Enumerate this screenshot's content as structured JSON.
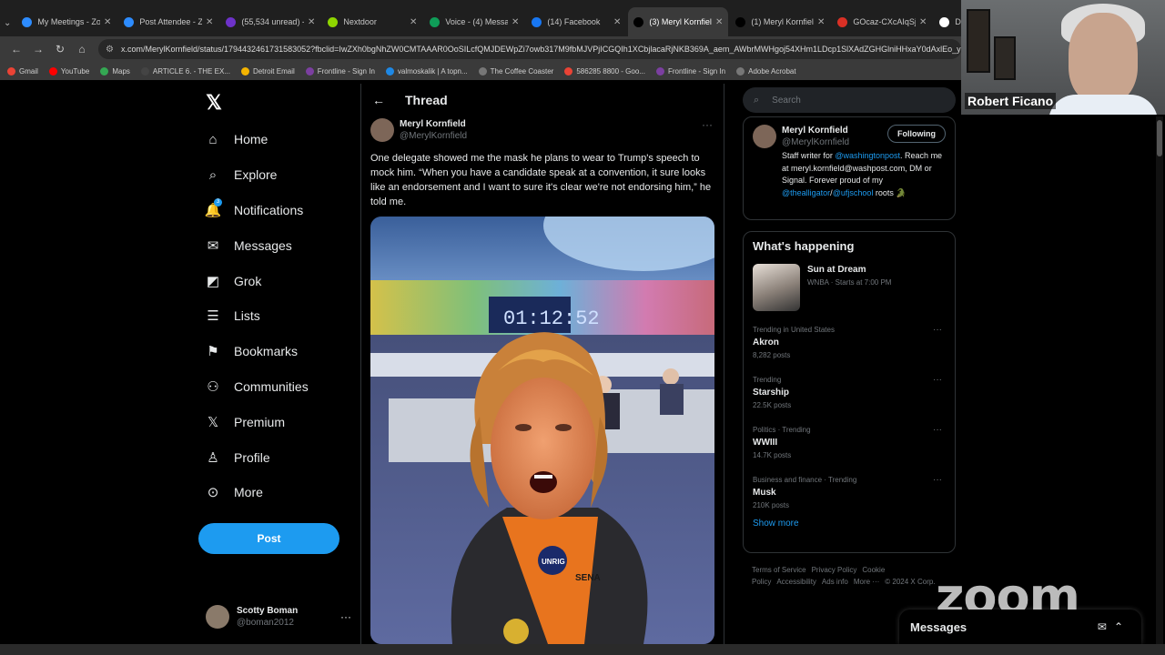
{
  "browser": {
    "tabs": [
      {
        "title": "My Meetings - Zo",
        "color": "#2d8cff",
        "icon": "zoom-icon"
      },
      {
        "title": "Post Attendee - Z",
        "color": "#2d8cff",
        "icon": "zoom-icon"
      },
      {
        "title": "(55,534 unread) -",
        "color": "#6d32c9",
        "icon": "mail-icon"
      },
      {
        "title": "Nextdoor",
        "color": "#8ed500",
        "icon": "nextdoor-icon"
      },
      {
        "title": "Voice - (4) Messag",
        "color": "#0f9d58",
        "icon": "phone-icon"
      },
      {
        "title": "(14) Facebook",
        "color": "#1877f2",
        "icon": "facebook-icon"
      },
      {
        "title": "(3) Meryl Kornfiel",
        "color": "#000000",
        "icon": "x-icon",
        "active": true
      },
      {
        "title": "(1) Meryl Kornfiel",
        "color": "#000000",
        "icon": "x-icon"
      },
      {
        "title": "GOcaz-CXcAIqSji",
        "color": "#d93025",
        "icon": "image-icon"
      },
      {
        "title": "Do",
        "color": "#ffffff",
        "icon": "doc-icon"
      }
    ],
    "url": "x.com/MerylKornfield/status/1794432461731583052?fbclid=IwZXh0bgNhZW0CMTAAAR0OoSILcfQMJDEWpZi7owb317M9fbMJVPjICGQIh1XCbjlacaRjNKB369A_aem_AWbrMWHgoj54XHm1LDcp1SlXAdZGHGlniHHxaY0dAxlEo_y",
    "bookmarks": [
      {
        "label": "Gmail",
        "color": "#ea4335"
      },
      {
        "label": "YouTube",
        "color": "#ff0000"
      },
      {
        "label": "Maps",
        "color": "#34a853"
      },
      {
        "label": "ARTICLE 6. - THE EX...",
        "color": "#444444"
      },
      {
        "label": "Detroit Email",
        "color": "#f4b400"
      },
      {
        "label": "Frontline - Sign In",
        "color": "#7b3fa0"
      },
      {
        "label": "valmoskalik | A topn...",
        "color": "#1e88e5"
      },
      {
        "label": "The Coffee Coaster",
        "color": "#777777"
      },
      {
        "label": "586285 8800 - Goo...",
        "color": "#ea4335"
      },
      {
        "label": "Frontline - Sign In",
        "color": "#7b3fa0"
      },
      {
        "label": "Adobe Acrobat",
        "color": "#777777"
      }
    ]
  },
  "video": {
    "participant_name": "Robert Ficano"
  },
  "nav": {
    "items": [
      {
        "label": "Home",
        "icon": "home-icon",
        "glyph": "⌂"
      },
      {
        "label": "Explore",
        "icon": "search-icon",
        "glyph": "⌕"
      },
      {
        "label": "Notifications",
        "icon": "bell-icon",
        "glyph": "🔔",
        "badge": "3"
      },
      {
        "label": "Messages",
        "icon": "mail-icon",
        "glyph": "✉"
      },
      {
        "label": "Grok",
        "icon": "grok-icon",
        "glyph": "◩"
      },
      {
        "label": "Lists",
        "icon": "list-icon",
        "glyph": "☰"
      },
      {
        "label": "Bookmarks",
        "icon": "bookmark-icon",
        "glyph": "⚑"
      },
      {
        "label": "Communities",
        "icon": "communities-icon",
        "glyph": "⚇"
      },
      {
        "label": "Premium",
        "icon": "x-premium-icon",
        "glyph": "𝕏"
      },
      {
        "label": "Profile",
        "icon": "profile-icon",
        "glyph": "♙"
      },
      {
        "label": "More",
        "icon": "more-circle-icon",
        "glyph": "⊙"
      }
    ],
    "post_label": "Post",
    "account": {
      "name": "Scotty Boman",
      "handle": "@boman2012"
    }
  },
  "thread": {
    "title": "Thread",
    "author_name": "Meryl Kornfield",
    "author_handle": "@MerylKornfield",
    "text": "One delegate showed me the mask he plans to wear to Trump's speech to mock  him. “When you have a candidate speak at a convention, it sure looks like an endorsement and I want to sure it's clear we're not endorsing him,” he told me.",
    "media_clock": "01:12:52",
    "media_button": "UNRIG",
    "media_shirt": "SENA"
  },
  "sidebar": {
    "search_placeholder": "Search",
    "profile": {
      "name": "Meryl Kornfield",
      "handle": "@MerylKornfield",
      "follow_label": "Following",
      "bio_a": "Staff writer for ",
      "bio_link1": "@washingtonpost",
      "bio_b": ". Reach me at meryl.kornfield@washpost.com, DM or Signal. Forever proud of my ",
      "bio_link2": "@thealligator",
      "bio_sep": "/",
      "bio_link3": "@ufjschool",
      "bio_c": " roots 🐊"
    },
    "whats_happening": {
      "title": "What's happening",
      "event": {
        "title": "Sun at Dream",
        "sub": "WNBA · Starts at 7:00 PM"
      },
      "trends": [
        {
          "meta": "Trending in United States",
          "title": "Akron",
          "count": "8,282 posts"
        },
        {
          "meta": "Trending",
          "title": "Starship",
          "count": "22.5K posts"
        },
        {
          "meta": "Politics · Trending",
          "title": "WWIII",
          "count": "14.7K posts"
        },
        {
          "meta": "Business and finance · Trending",
          "title": "Musk",
          "count": "210K posts"
        }
      ],
      "show_more": "Show more"
    },
    "footer": {
      "links": [
        "Terms of Service",
        "Privacy Policy",
        "Cookie Policy",
        "Accessibility",
        "Ads info",
        "More ···"
      ],
      "copyright": "© 2024 X Corp."
    }
  },
  "zoom": {
    "logo": "zoom"
  },
  "messages_drawer": {
    "title": "Messages"
  }
}
